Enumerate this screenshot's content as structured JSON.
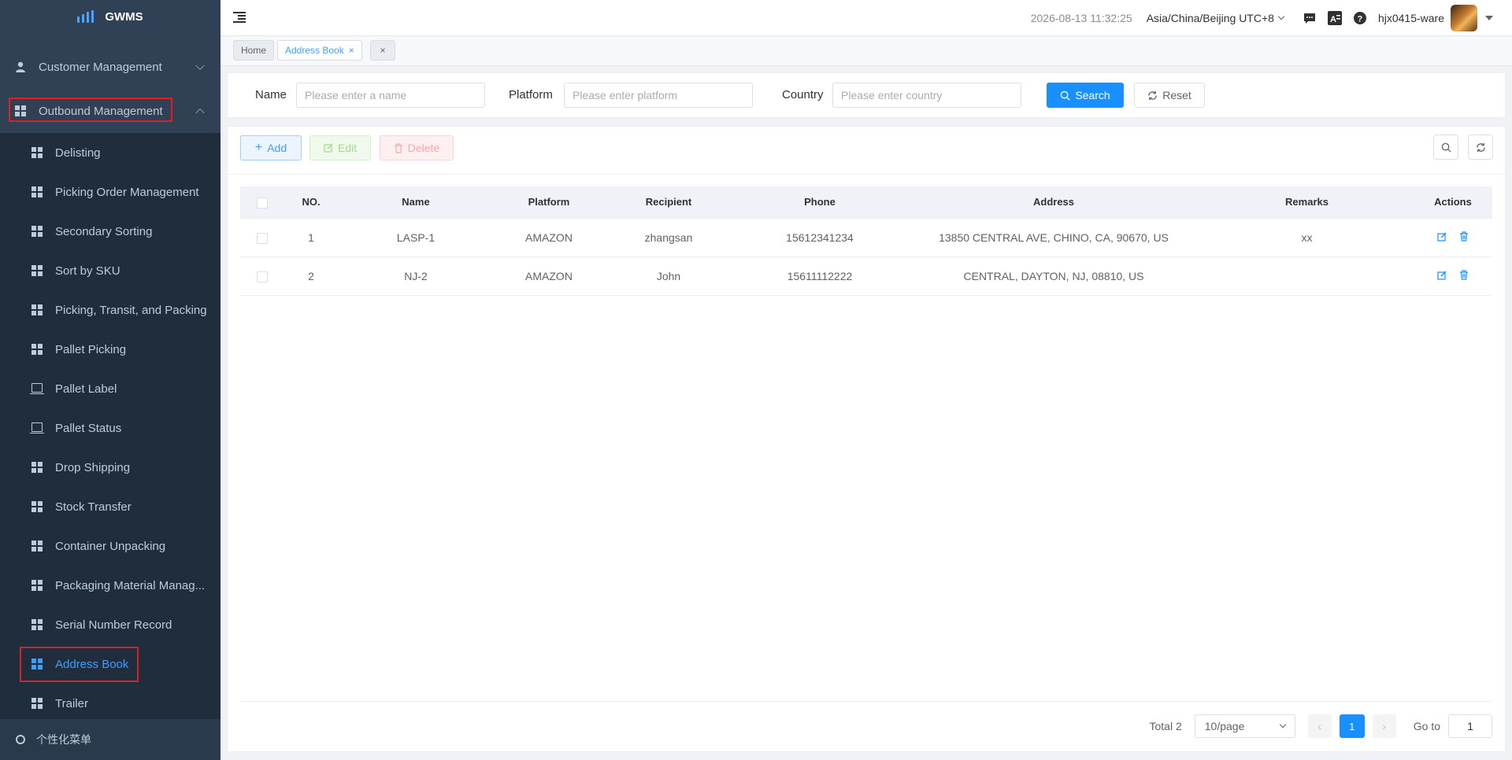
{
  "app": {
    "name": "GWMS"
  },
  "sidebar": {
    "groups": [
      {
        "label": "Customer Management",
        "icon": "user-icon"
      },
      {
        "label": "Outbound Management",
        "icon": "grid-icon"
      }
    ],
    "items": [
      {
        "label": "Delisting",
        "icon": "grid-icon"
      },
      {
        "label": "Picking Order Management",
        "icon": "grid-icon"
      },
      {
        "label": "Secondary Sorting",
        "icon": "grid-icon"
      },
      {
        "label": "Sort by SKU",
        "icon": "grid-icon"
      },
      {
        "label": "Picking, Transit, and Packing",
        "icon": "grid-icon"
      },
      {
        "label": "Pallet Picking",
        "icon": "grid-icon"
      },
      {
        "label": "Pallet Label",
        "icon": "pallet-icon"
      },
      {
        "label": "Pallet Status",
        "icon": "pallet-icon"
      },
      {
        "label": "Drop Shipping",
        "icon": "grid-icon"
      },
      {
        "label": "Stock Transfer",
        "icon": "grid-icon"
      },
      {
        "label": "Container Unpacking",
        "icon": "grid-icon"
      },
      {
        "label": "Packaging Material Manag...",
        "icon": "grid-icon"
      },
      {
        "label": "Serial Number Record",
        "icon": "grid-icon"
      },
      {
        "label": "Address Book",
        "icon": "grid-icon"
      },
      {
        "label": "Trailer",
        "icon": "grid-icon"
      }
    ],
    "footer": "个性化菜单"
  },
  "header": {
    "datetime": "2026-08-13 11:32:25",
    "timezone": "Asia/China/Beijing UTC+8",
    "username": "hjx0415-ware"
  },
  "tags": {
    "home": "Home",
    "active": "Address Book",
    "close": "×"
  },
  "filters": {
    "name_label": "Name",
    "name_placeholder": "Please enter a name",
    "platform_label": "Platform",
    "platform_placeholder": "Please enter platform",
    "country_label": "Country",
    "country_placeholder": "Please enter country",
    "search": "Search",
    "reset": "Reset"
  },
  "toolbar": {
    "add": "Add",
    "edit": "Edit",
    "delete": "Delete"
  },
  "table": {
    "columns": [
      "NO.",
      "Name",
      "Platform",
      "Recipient",
      "Phone",
      "Address",
      "Remarks",
      "Actions"
    ],
    "rows": [
      {
        "no": "1",
        "name": "LASP-1",
        "platform": "AMAZON",
        "recipient": "zhangsan",
        "phone": "15612341234",
        "address": "13850 CENTRAL AVE, CHINO, CA, 90670, US",
        "remarks": "xx"
      },
      {
        "no": "2",
        "name": "NJ-2",
        "platform": "AMAZON",
        "recipient": "John",
        "phone": "15611112222",
        "address": "CENTRAL, DAYTON, NJ, 08810, US",
        "remarks": ""
      }
    ]
  },
  "pagination": {
    "total": "Total 2",
    "page_size": "10/page",
    "current": "1",
    "goto_label": "Go to",
    "goto_value": "1"
  },
  "colors": {
    "primary": "#1890ff",
    "sidebar": "#304156",
    "submenu": "#1f2d3d",
    "highlight": "#e02020"
  }
}
